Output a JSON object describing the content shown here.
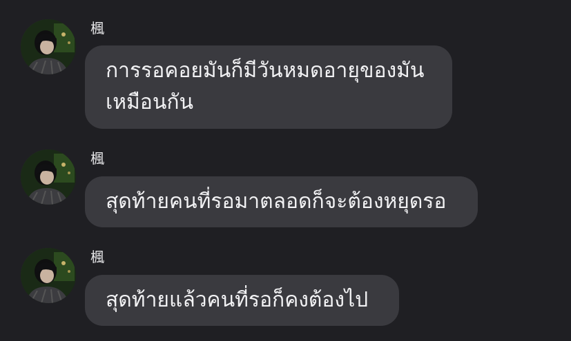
{
  "messages": [
    {
      "sender": "楓",
      "text": "การรอคอยมันก็มีวันหมดอายุของมัน\nเหมือนกัน"
    },
    {
      "sender": "楓",
      "text": "สุดท้ายคนที่รอมาตลอดก็จะต้องหยุดรอ"
    },
    {
      "sender": "楓",
      "text": "สุดท้ายแล้วคนที่รอก็คงต้องไป"
    }
  ]
}
